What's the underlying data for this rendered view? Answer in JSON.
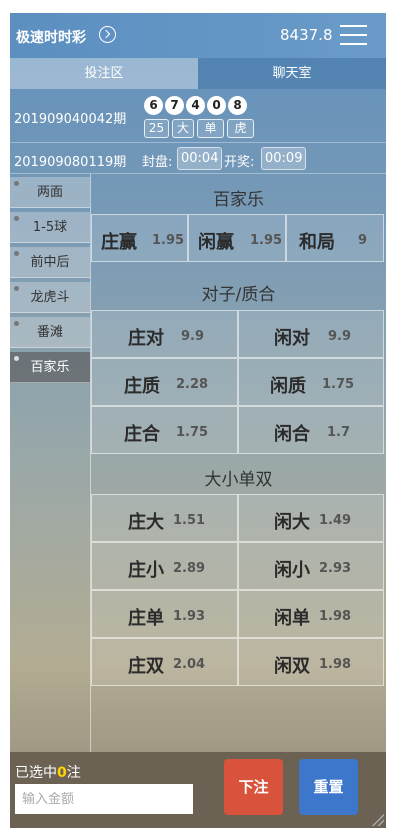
{
  "header": {
    "title": "极速时时彩",
    "balance": "8437.8"
  },
  "tabs": [
    "投注区",
    "聊天室"
  ],
  "draw": {
    "issue": "201909040042期",
    "balls": [
      "6",
      "7",
      "4",
      "0",
      "8"
    ],
    "tags": [
      "25",
      "大",
      "单",
      "虎"
    ]
  },
  "countdown": {
    "issue": "201909080119期",
    "close_label": "封盘:",
    "close_time": "00:04",
    "open_label": "开奖:",
    "open_time": "00:09"
  },
  "sidebar": {
    "items": [
      "两面",
      "1-5球",
      "前中后",
      "龙虎斗",
      "番滩",
      "百家乐"
    ],
    "active": "百家乐"
  },
  "sections": [
    {
      "title": "百家乐",
      "cells": [
        {
          "name": "庄赢",
          "odds": "1.95"
        },
        {
          "name": "闲赢",
          "odds": "1.95"
        },
        {
          "name": "和局",
          "odds": "9"
        }
      ]
    },
    {
      "title": "对子/质合",
      "cells": [
        {
          "name": "庄对",
          "odds": "9.9"
        },
        {
          "name": "闲对",
          "odds": "9.9"
        },
        {
          "name": "庄质",
          "odds": "2.28"
        },
        {
          "name": "闲质",
          "odds": "1.75"
        },
        {
          "name": "庄合",
          "odds": "1.75"
        },
        {
          "name": "闲合",
          "odds": "1.7"
        }
      ]
    },
    {
      "title": "大小单双",
      "cells": [
        {
          "name": "庄大",
          "odds": "1.51"
        },
        {
          "name": "闲大",
          "odds": "1.49"
        },
        {
          "name": "庄小",
          "odds": "2.89"
        },
        {
          "name": "闲小",
          "odds": "2.93"
        },
        {
          "name": "庄单",
          "odds": "1.93"
        },
        {
          "name": "闲单",
          "odds": "1.98"
        },
        {
          "name": "庄双",
          "odds": "2.04"
        },
        {
          "name": "闲双",
          "odds": "1.98"
        }
      ]
    }
  ],
  "footer": {
    "selected_prefix": "已选中",
    "selected_count": "0",
    "selected_suffix": "注",
    "amount_placeholder": "输入金额",
    "bet_label": "下注",
    "reset_label": "重置"
  },
  "icons": [
    "chevron-right-circle-icon",
    "hamburger-menu-icon",
    "resize-grip-icon"
  ]
}
